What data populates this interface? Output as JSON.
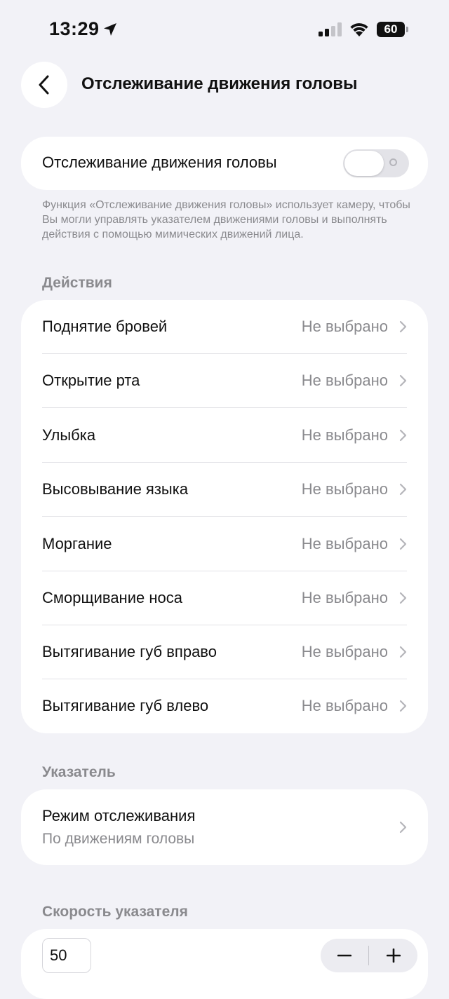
{
  "status_bar": {
    "time": "13:29",
    "battery": "60"
  },
  "header": {
    "title": "Отслеживание движения головы"
  },
  "head_tracking": {
    "label": "Отслеживание движения головы",
    "enabled": false,
    "description": "Функция «Отслеживание движения головы» использует камеру, чтобы Вы могли управлять указателем движени­ями головы и выполнять действия с помощью мимических движений лица."
  },
  "actions": {
    "header": "Действия",
    "items": [
      {
        "label": "Поднятие бровей",
        "value": "Не выбрано"
      },
      {
        "label": "Открытие рта",
        "value": "Не выбрано"
      },
      {
        "label": "Улыбка",
        "value": "Не выбрано"
      },
      {
        "label": "Высовывание языка",
        "value": "Не выбрано"
      },
      {
        "label": "Моргание",
        "value": "Не выбрано"
      },
      {
        "label": "Сморщивание носа",
        "value": "Не выбрано"
      },
      {
        "label": "Вытягивание губ вправо",
        "value": "Не выбрано"
      },
      {
        "label": "Вытягивание губ влево",
        "value": "Не выбрано"
      }
    ]
  },
  "pointer": {
    "header": "Указатель",
    "mode_label": "Режим отслеживания",
    "mode_value": "По движениям головы"
  },
  "speed": {
    "header": "Скорость указателя",
    "value": "50"
  }
}
